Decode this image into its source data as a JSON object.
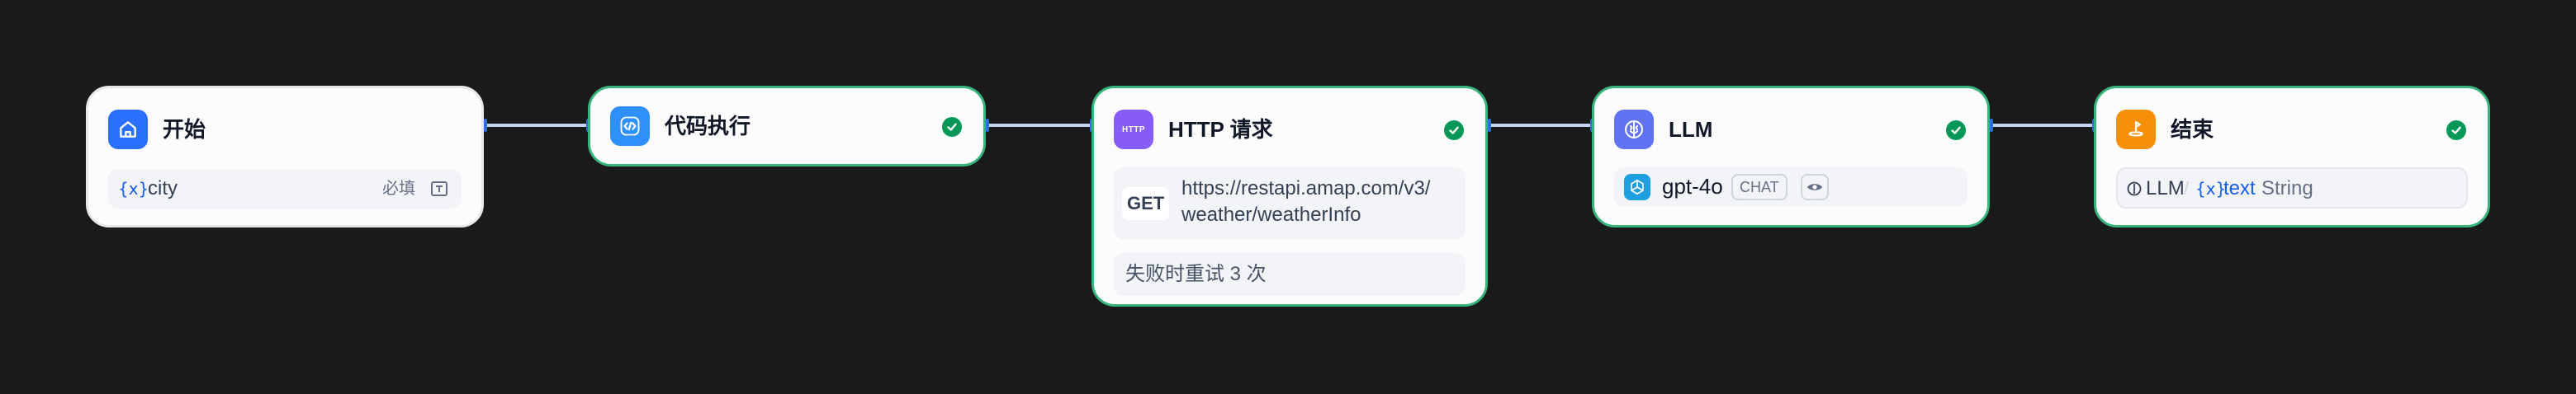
{
  "nodes": {
    "start": {
      "title": "开始",
      "variable": {
        "prefix": "{x}",
        "name": "city",
        "required": "必填"
      }
    },
    "code": {
      "title": "代码执行"
    },
    "http": {
      "title": "HTTP 请求",
      "method": "GET",
      "url_line1": "https://restapi.amap.com/v3/",
      "url_line2": "weather/weatherInfo",
      "retry": "失败时重试 3 次"
    },
    "llm": {
      "title": "LLM",
      "model": "gpt-4o",
      "mode": "CHAT"
    },
    "end": {
      "title": "结束",
      "output": {
        "source": "LLM",
        "separator": "/",
        "prefix": "{x}",
        "name": "text",
        "type": "String"
      }
    }
  },
  "colors": {
    "canvas_bg": "#1a1a1a",
    "node_bg": "#fcfcfd",
    "success_border": "#37b57a",
    "success_icon": "#039855",
    "edge": "#c3d4f7",
    "start_icon_bg": "#2970ff",
    "code_icon_bg": "#2e90fa",
    "http_icon_bg": "#875bf7",
    "llm_icon_bg": "#6172f3",
    "end_icon_bg": "#f79009",
    "variable_accent": "#155eef"
  },
  "icons": {
    "start": "home-icon",
    "code": "code-icon",
    "http": "http-icon",
    "llm": "brain-icon",
    "end": "flag-icon",
    "status": "check-circle-icon",
    "model": "openai-icon",
    "mode_toggle": "eye-icon",
    "required": "text-input-icon"
  }
}
